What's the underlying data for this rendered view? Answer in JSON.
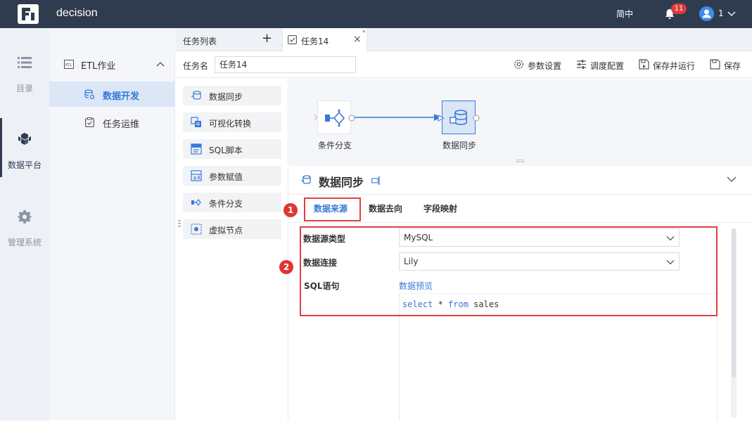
{
  "header": {
    "app_title": "decision",
    "language": "简中",
    "notification_count": "11",
    "user_name": "1",
    "bg_color": "#2f3c4f"
  },
  "leftnav": {
    "items": [
      {
        "label": "目录",
        "icon": "list-icon",
        "active": false
      },
      {
        "label": "数据平台",
        "icon": "cubes-icon",
        "active": true
      },
      {
        "label": "管理系统",
        "icon": "gear-icon",
        "active": false
      }
    ]
  },
  "subnav": {
    "group_label": "ETL作业",
    "items": [
      {
        "label": "数据开发",
        "icon": "database-icon",
        "active": true
      },
      {
        "label": "任务运维",
        "icon": "clipboard-icon",
        "active": false
      }
    ]
  },
  "tabs": {
    "list_label": "任务列表",
    "add_label": "+",
    "active_tab": "任务14",
    "close_label": "×",
    "modified_mark": "*"
  },
  "task": {
    "name_label": "任务名",
    "name_value": "任务14"
  },
  "toolbar": {
    "params": "参数设置",
    "schedule": "调度配置",
    "save_run": "保存并运行",
    "save": "保存"
  },
  "palette": {
    "items": [
      {
        "label": "数据同步",
        "icon": "data-sync-icon"
      },
      {
        "label": "可视化转换",
        "icon": "visual-transform-icon"
      },
      {
        "label": "SQL脚本",
        "icon": "sql-script-icon"
      },
      {
        "label": "参数赋值",
        "icon": "param-assign-icon"
      },
      {
        "label": "条件分支",
        "icon": "condition-branch-icon"
      },
      {
        "label": "虚拟节点",
        "icon": "virtual-node-icon"
      }
    ]
  },
  "canvas": {
    "nodes": [
      {
        "label": "条件分支",
        "icon": "condition-branch-icon"
      },
      {
        "label": "数据同步",
        "icon": "data-sync-icon",
        "selected": true
      }
    ]
  },
  "props": {
    "title": "数据同步",
    "tabs": [
      {
        "label": "数据来源",
        "active": true
      },
      {
        "label": "数据去向",
        "active": false
      },
      {
        "label": "字段映射",
        "active": false
      }
    ],
    "markers": [
      "1",
      "2"
    ],
    "source_type_label": "数据源类型",
    "source_type_value": "MySQL",
    "connection_label": "数据连接",
    "connection_value": "Lily",
    "sql_label": "SQL语句",
    "preview_link": "数据预览",
    "sql": {
      "kw_select": "select",
      "star": " * ",
      "kw_from": "from",
      "table": " sales"
    }
  }
}
